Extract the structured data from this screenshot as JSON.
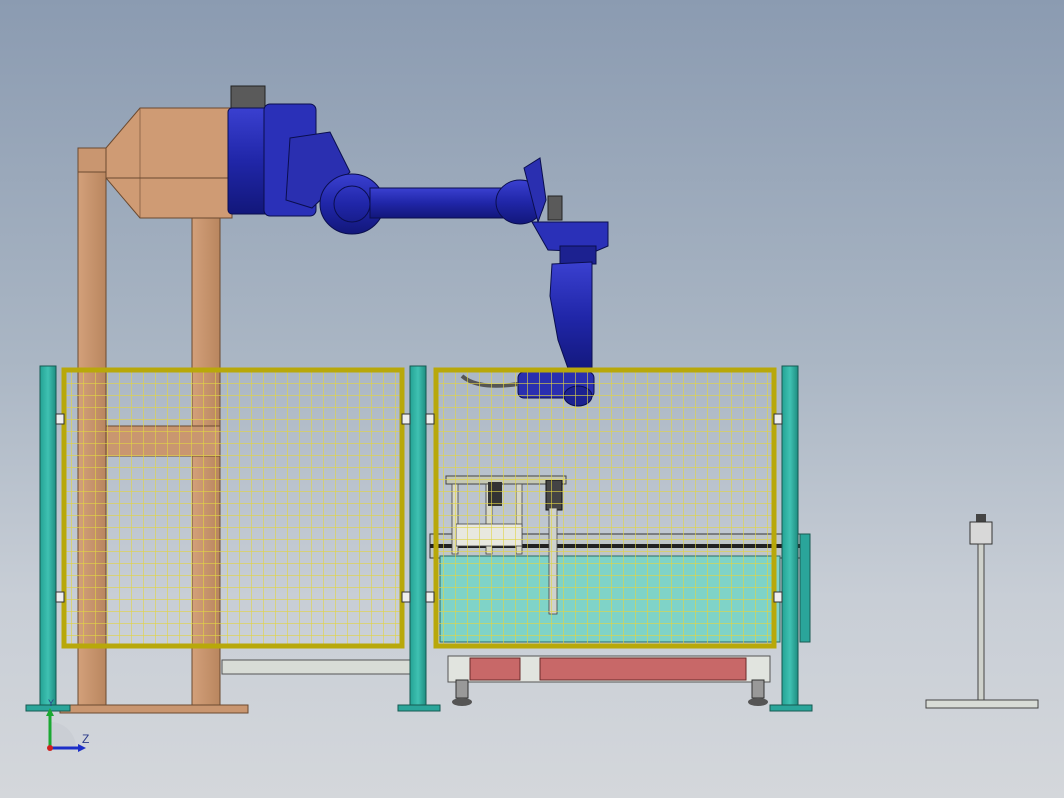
{
  "viewport": {
    "background_top": "#8b9bb1",
    "background_bottom": "#d4d7db"
  },
  "colors": {
    "robot_blue": "#2a2fb0",
    "robot_dark": "#141a6e",
    "frame_tan": "#c99670",
    "fence_yellow": "#e7d84a",
    "fence_frame": "#b8a80a",
    "post_teal": "#2aa59a",
    "tank_cyan": "#7fd3c8",
    "conveyor_red": "#c86868"
  },
  "triad": {
    "y_label": "Y",
    "z_label": "Z"
  }
}
